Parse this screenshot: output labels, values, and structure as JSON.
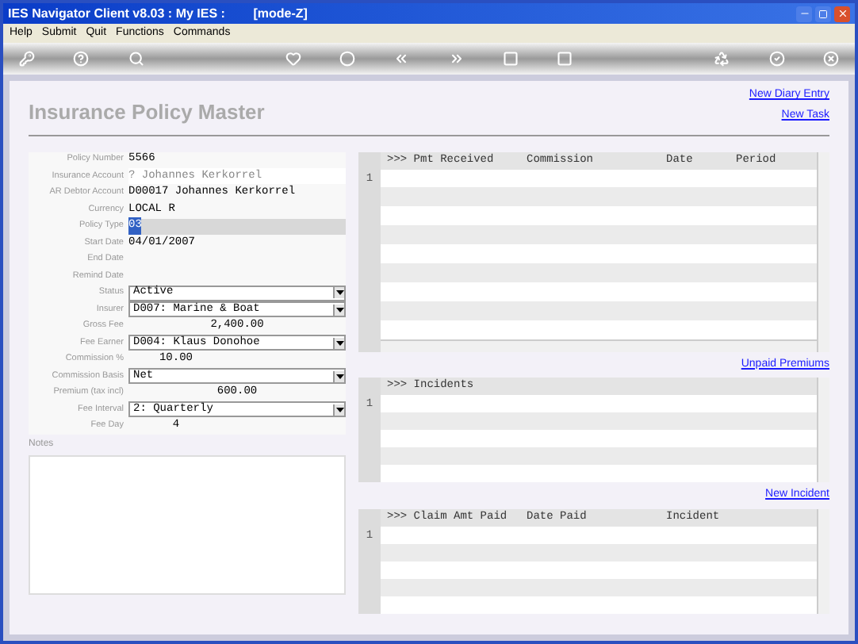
{
  "window": {
    "title": "IES Navigator Client v8.03 : My IES :        [mode-Z]"
  },
  "menu": [
    "Help",
    "Submit",
    "Quit",
    "Functions",
    "Commands"
  ],
  "page": {
    "title": "Insurance Policy Master",
    "links": [
      "New Diary Entry",
      "New Task"
    ]
  },
  "fields": [
    {
      "label": "Policy Number",
      "kind": "text",
      "value": "5566"
    },
    {
      "label": "Insurance Account",
      "kind": "readonly",
      "value": "? Johannes Kerkorrel"
    },
    {
      "label": "AR Debtor Account",
      "kind": "text",
      "value": "D00017 Johannes Kerkorrel"
    },
    {
      "label": "Currency",
      "kind": "text",
      "value": "LOCAL R"
    },
    {
      "label": "Policy Type",
      "kind": "focused",
      "value": "03"
    },
    {
      "label": "Start Date",
      "kind": "text",
      "value": "04/01/2007"
    },
    {
      "label": "End Date",
      "kind": "text"
    },
    {
      "label": "Remind Date",
      "kind": "text"
    },
    {
      "label": "Status",
      "kind": "select",
      "value": "Active"
    },
    {
      "label": "Insurer",
      "kind": "select",
      "value": "D007: Marine & Boat"
    },
    {
      "label": "Gross Fee",
      "kind": "number",
      "value": "2,400.00"
    },
    {
      "label": "Fee Earner",
      "kind": "select",
      "value": "D004: Klaus Donohoe"
    },
    {
      "label": "Commission %",
      "kind": "short",
      "value": "10.00"
    },
    {
      "label": "Commission Basis",
      "kind": "select",
      "value": "Net"
    },
    {
      "label": "Premium (tax incl)",
      "kind": "number",
      "value": "600.00"
    },
    {
      "label": "Fee Interval",
      "kind": "select",
      "value": "2: Quarterly"
    },
    {
      "label": "Fee Day",
      "kind": "short",
      "value": "4"
    }
  ],
  "notes": {
    "label": "Notes"
  },
  "grids": [
    {
      "columns": [
        ">>> Pmt Received",
        "Commission",
        "Date",
        "Period"
      ],
      "row_number": "1",
      "hscroll": true,
      "link_below": "Unpaid Premiums"
    },
    {
      "columns": [
        ">>> Incidents"
      ],
      "row_number": "1",
      "hscroll": false,
      "link_below": "New Incident"
    },
    {
      "columns": [
        ">>> Claim Amt Paid",
        "Date Paid",
        "Incident"
      ],
      "row_number": "1",
      "hscroll": false
    }
  ]
}
